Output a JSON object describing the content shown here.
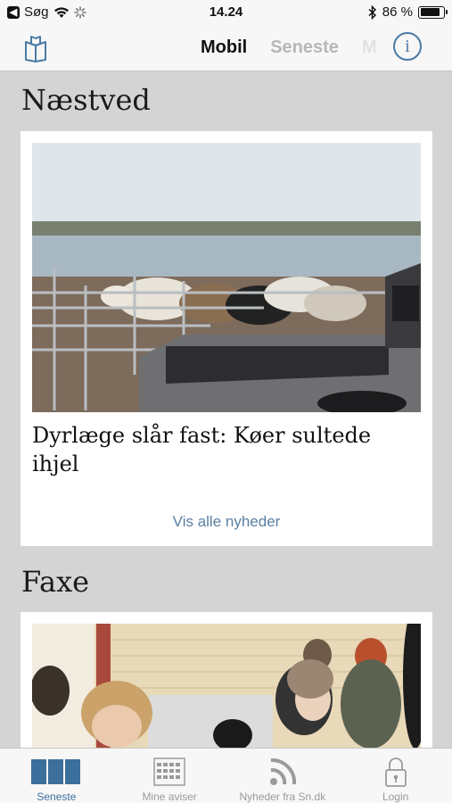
{
  "status": {
    "carrier": "Søg",
    "back_glyph": "◀",
    "time": "14.24",
    "battery": "86 %",
    "battery_level": 0.86
  },
  "nav": {
    "tabs": [
      "Mobil",
      "Seneste",
      "M"
    ],
    "info_glyph": "i"
  },
  "sections": [
    {
      "title": "Næstved",
      "headline": "Dyrlæge slår fast: Køer sultede ihjel",
      "link": "Vis alle nyheder"
    },
    {
      "title": "Faxe"
    }
  ],
  "tabbar": {
    "items": [
      "Seneste",
      "Mine aviser",
      "Nyheder fra Sn.dk",
      "Login"
    ],
    "active": 0
  },
  "colors": {
    "accent": "#3d6f9c",
    "link": "#5b7fa3",
    "background": "#d4d4d4"
  }
}
